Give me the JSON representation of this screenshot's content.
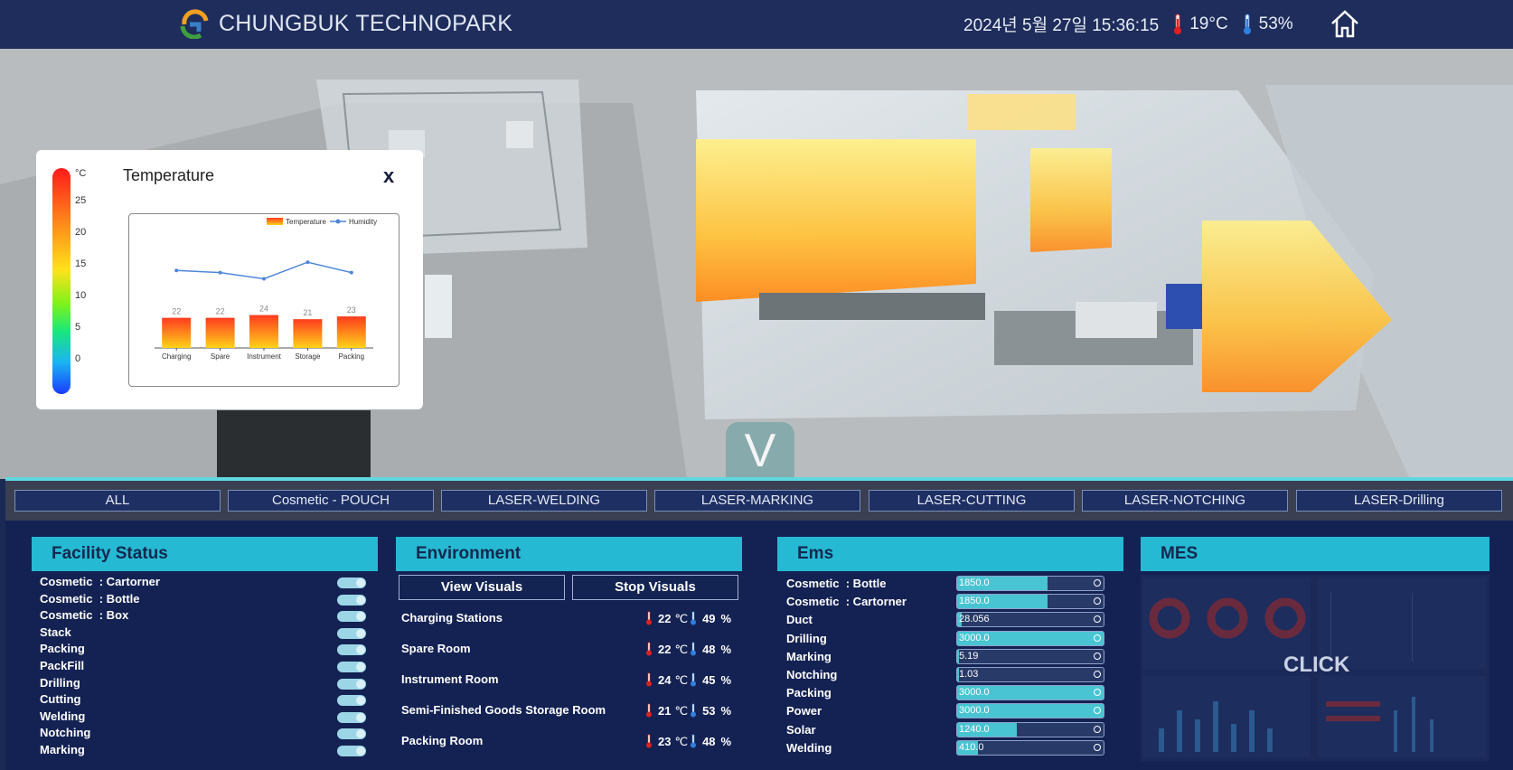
{
  "header": {
    "brand": "CHUNGBUK TECHNOPARK",
    "datetime": "2024년 5월 27일 15:36:15",
    "temperature": "19°C",
    "humidity": "53%"
  },
  "scene": {
    "toggle_label": "V"
  },
  "temperature_popup": {
    "title": "Temperature",
    "close_label": "x",
    "scale_unit": "°C",
    "scale_ticks": [
      "25",
      "20",
      "15",
      "10",
      "5",
      "0"
    ],
    "chart_data": {
      "type": "bar",
      "categories": [
        "Charging",
        "Spare",
        "Instrument",
        "Storage",
        "Packing"
      ],
      "series": [
        {
          "name": "Temperature",
          "values": [
            22,
            22,
            24,
            21,
            23
          ]
        },
        {
          "name": "Humidity",
          "values": [
            49,
            48,
            45,
            53,
            48
          ]
        }
      ],
      "legend": "top-right",
      "colors": {
        "temperature_top": "#ff3b1f",
        "temperature_bottom": "#ffd21a",
        "humidity": "#4f86d9"
      }
    }
  },
  "tabs": [
    "ALL",
    "Cosmetic - POUCH",
    "LASER-WELDING",
    "LASER-MARKING",
    "LASER-CUTTING",
    "LASER-NOTCHING",
    "LASER-Drilling"
  ],
  "facility": {
    "title": "Facility Status",
    "items": [
      "Cosmetic  : Cartorner",
      "Cosmetic  : Bottle",
      "Cosmetic  : Box",
      "Stack",
      "Packing",
      "PackFill",
      "Drilling",
      "Cutting",
      "Welding",
      "Notching",
      "Marking"
    ]
  },
  "environment": {
    "title": "Environment",
    "view_label": "View Visuals",
    "stop_label": "Stop Visuals",
    "rows": [
      {
        "name": "Charging Stations",
        "temp": "22",
        "hum": "49"
      },
      {
        "name": "Spare Room",
        "temp": "22",
        "hum": "48"
      },
      {
        "name": "Instrument Room",
        "temp": "24",
        "hum": "45"
      },
      {
        "name": "Semi-Finished Goods Storage Room",
        "temp": "21",
        "hum": "53"
      },
      {
        "name": "Packing Room",
        "temp": "23",
        "hum": "48"
      }
    ],
    "temp_unit": "℃",
    "hum_unit": "%"
  },
  "ems": {
    "title": "Ems",
    "rows": [
      {
        "name": "Cosmetic  : Bottle",
        "value": "1850.0",
        "fill": 0.62
      },
      {
        "name": "Cosmetic  : Cartorner",
        "value": "1850.0",
        "fill": 0.62
      },
      {
        "name": "Duct",
        "value": "28.056",
        "fill": 0.03
      },
      {
        "name": "Drilling",
        "value": "3000.0",
        "fill": 1.0
      },
      {
        "name": "Marking",
        "value": "5.19",
        "fill": 0.01
      },
      {
        "name": "Notching",
        "value": "1.03",
        "fill": 0.01
      },
      {
        "name": "Packing",
        "value": "3000.0",
        "fill": 1.0
      },
      {
        "name": "Power",
        "value": "3000.0",
        "fill": 1.0
      },
      {
        "name": "Solar",
        "value": "1240.0",
        "fill": 0.41
      },
      {
        "name": "Welding",
        "value": "410.0",
        "fill": 0.14
      }
    ]
  },
  "mes": {
    "title": "MES",
    "click_label": "CLICK"
  }
}
